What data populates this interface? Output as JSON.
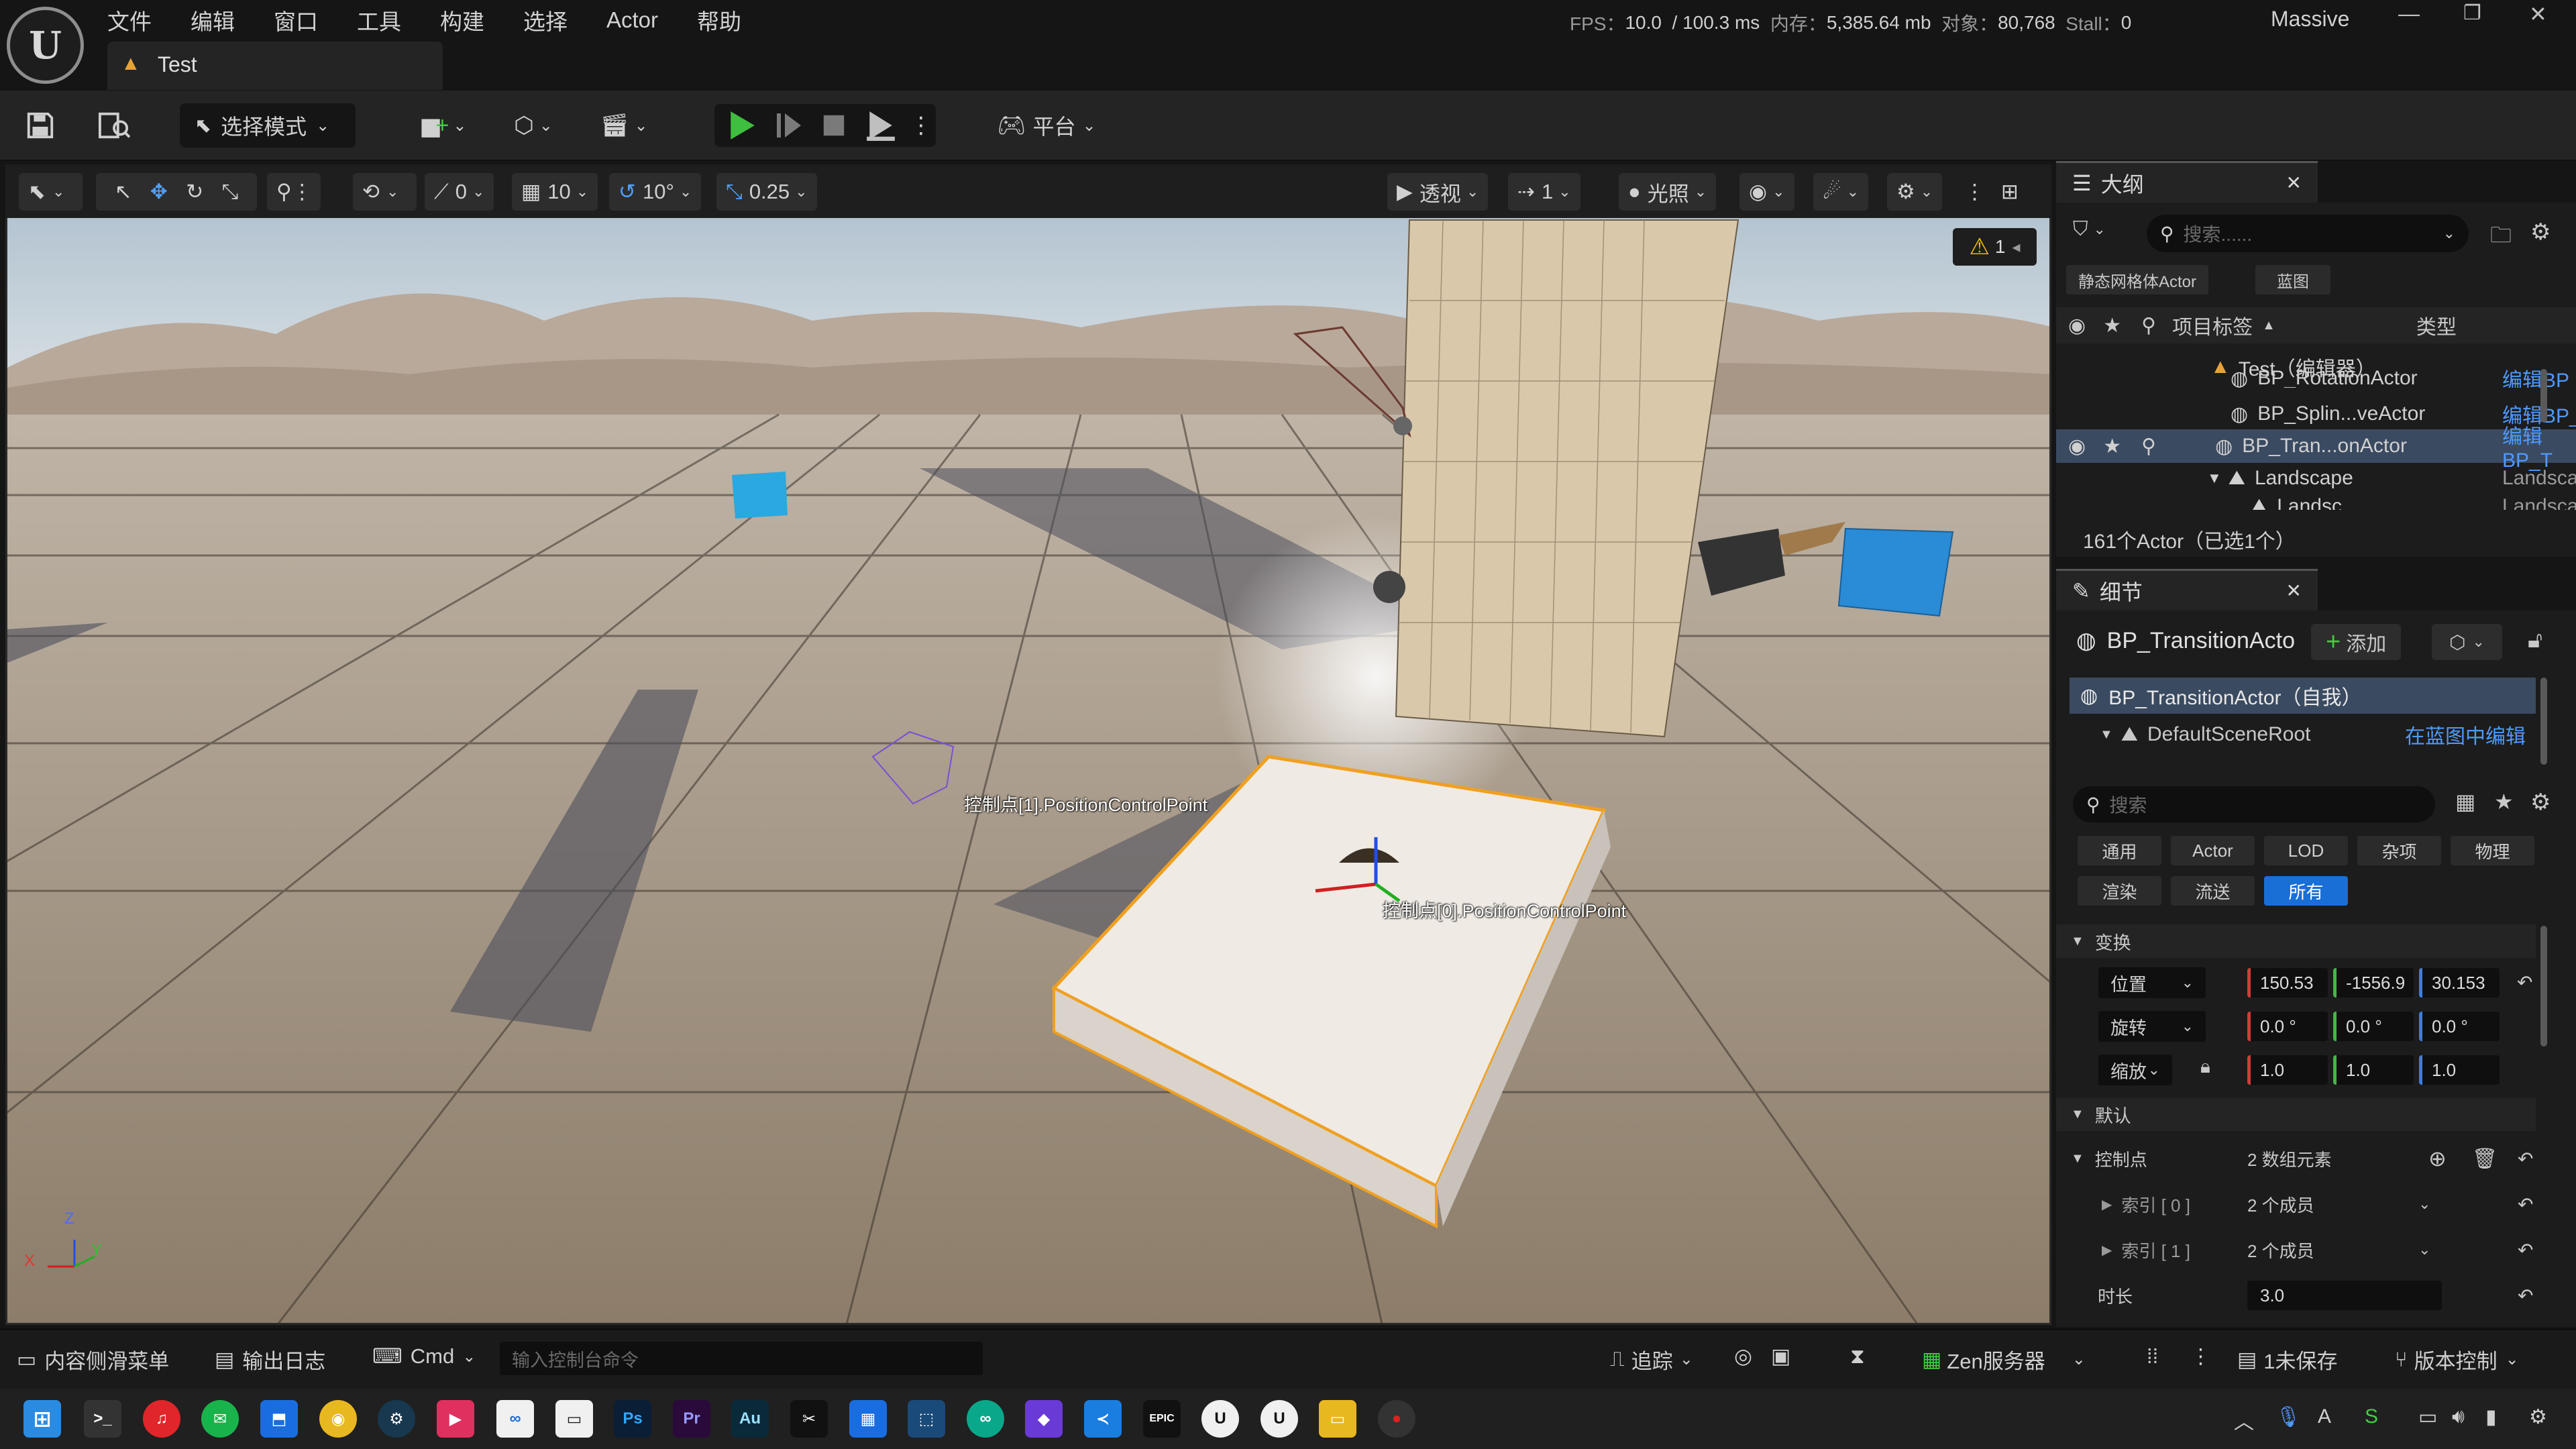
{
  "app": {
    "menu": [
      "文件",
      "编辑",
      "窗口",
      "工具",
      "构建",
      "选择",
      "Actor",
      "帮助"
    ],
    "level_tab": "Test",
    "project": "Massive",
    "stats": {
      "fps_label": "FPS：",
      "fps": "10.0",
      "ms": "/ 100.3 ms",
      "mem_label": "内存：",
      "mem": "5,385.64 mb",
      "obj_label": "对象：",
      "obj": "80,768",
      "stall_label": "Stall：",
      "stall": "0"
    }
  },
  "toolbar": {
    "mode": "选择模式",
    "platform": "平台"
  },
  "viewport_toolbar": {
    "move_snap": "0",
    "grid_snap": "10",
    "rot_snap": "10°",
    "scale_snap": "0.25",
    "view_mode": "透视",
    "camera_speed": "1",
    "lighting": "光照"
  },
  "viewport": {
    "warning_count": "1",
    "label_cp1": "控制点[1].PositionControlPoint",
    "label_cp0": "控制点[0].PositionControlPoint",
    "axis_x": "X",
    "axis_y": "Y",
    "axis_z": "Z"
  },
  "outliner": {
    "tab": "大纲",
    "search_placeholder": "搜索......",
    "filter_chips": [
      "静态网格体Actor",
      "蓝图"
    ],
    "col_label": "项目标签",
    "col_type": "类型",
    "rows": [
      {
        "label": "Test（编辑器）",
        "type": ""
      },
      {
        "label": "BP_RotationActor",
        "type": "编辑BP_R"
      },
      {
        "label": "BP_Splin...veActor",
        "type": "编辑BP_S"
      },
      {
        "label": "BP_Tran...onActor",
        "type": "编辑BP_T"
      },
      {
        "label": "Landscape",
        "type": "Landscap"
      },
      {
        "label": "Landsc...",
        "type": "Landscap"
      }
    ],
    "footer": "161个Actor（已选1个）"
  },
  "details": {
    "tab": "细节",
    "actor_name": "BP_TransitionActo",
    "add_label": "添加",
    "comp_self": "BP_TransitionActor（自我）",
    "comp_root": "DefaultSceneRoot",
    "comp_root_link": "在蓝图中编辑",
    "search_placeholder": "搜索",
    "categories": [
      "通用",
      "Actor",
      "LOD",
      "杂项",
      "物理",
      "渲染",
      "流送",
      "所有"
    ],
    "section_transform": "变换",
    "location_label": "位置",
    "location": [
      "150.53",
      "-1556.9",
      "30.153"
    ],
    "rotation_label": "旋转",
    "rotation": [
      "0.0 °",
      "0.0 °",
      "0.0 °"
    ],
    "scale_label": "缩放",
    "scale": [
      "1.0",
      "1.0",
      "1.0"
    ],
    "section_default": "默认",
    "control_points_label": "控制点",
    "control_points_value": "2 数组元素",
    "index0_label": "索引 [ 0 ]",
    "index0_value": "2 个成员",
    "index1_label": "索引 [ 1 ]",
    "index1_value": "2 个成员",
    "duration_label": "时长",
    "duration_value": "3.0"
  },
  "statusbar": {
    "content_drawer": "内容侧滑菜单",
    "output_log": "输出日志",
    "cmd": "Cmd",
    "console_placeholder": "输入控制台命令",
    "trace": "追踪",
    "zen": "Zen服务器",
    "unsaved": "1未保存",
    "source_control": "版本控制"
  }
}
